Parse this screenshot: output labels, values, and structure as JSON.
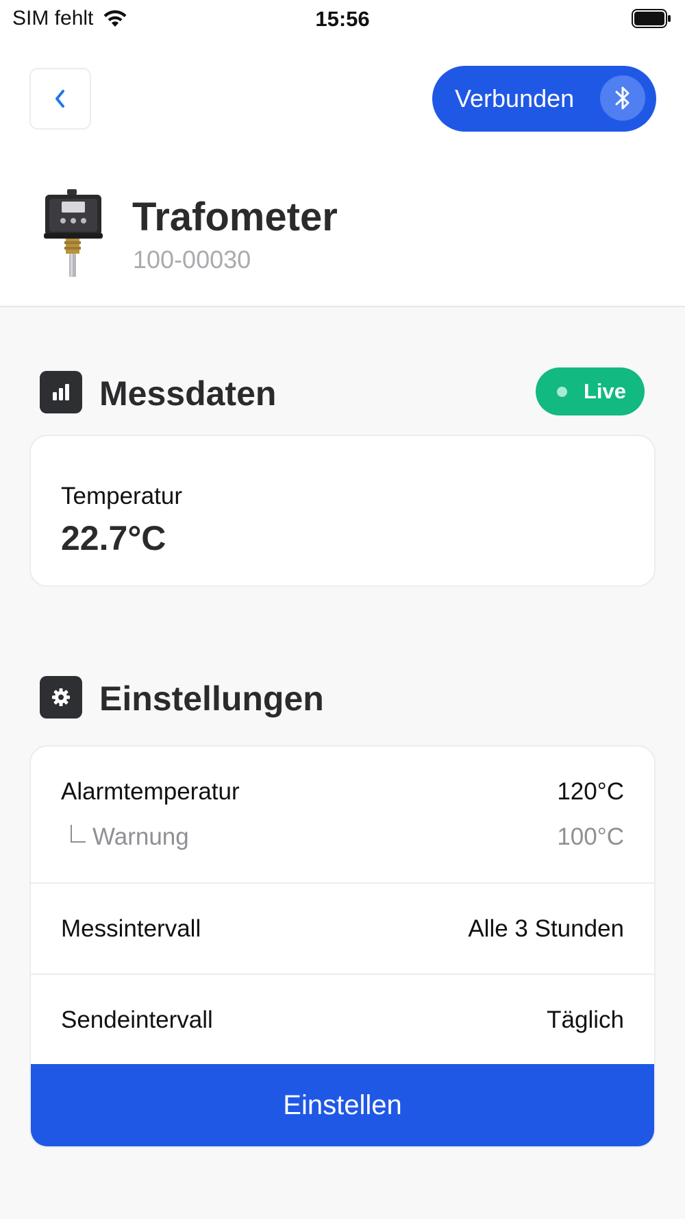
{
  "status_bar": {
    "carrier": "SIM fehlt",
    "time": "15:56"
  },
  "nav": {
    "back_icon": "chevron-left-icon",
    "connection_label": "Verbunden",
    "connection_icon": "bluetooth-icon"
  },
  "device": {
    "name": "Trafometer",
    "id": "100-00030"
  },
  "measurements": {
    "title": "Messdaten",
    "icon": "bar-chart-icon",
    "live_label": "Live",
    "metric_label": "Temperatur",
    "metric_value": "22.7°C"
  },
  "settings": {
    "title": "Einstellungen",
    "icon": "gear-icon",
    "alarm_label": "Alarmtemperatur",
    "alarm_value": "120°C",
    "warning_label": "Warnung",
    "warning_value": "100°C",
    "measure_interval_label": "Messintervall",
    "measure_interval_value": "Alle 3 Stunden",
    "send_interval_label": "Sendeintervall",
    "send_interval_value": "Täglich",
    "button_label": "Einstellen"
  },
  "colors": {
    "accent": "#2058e6",
    "live": "#12b981",
    "dark": "#2e2f33"
  }
}
